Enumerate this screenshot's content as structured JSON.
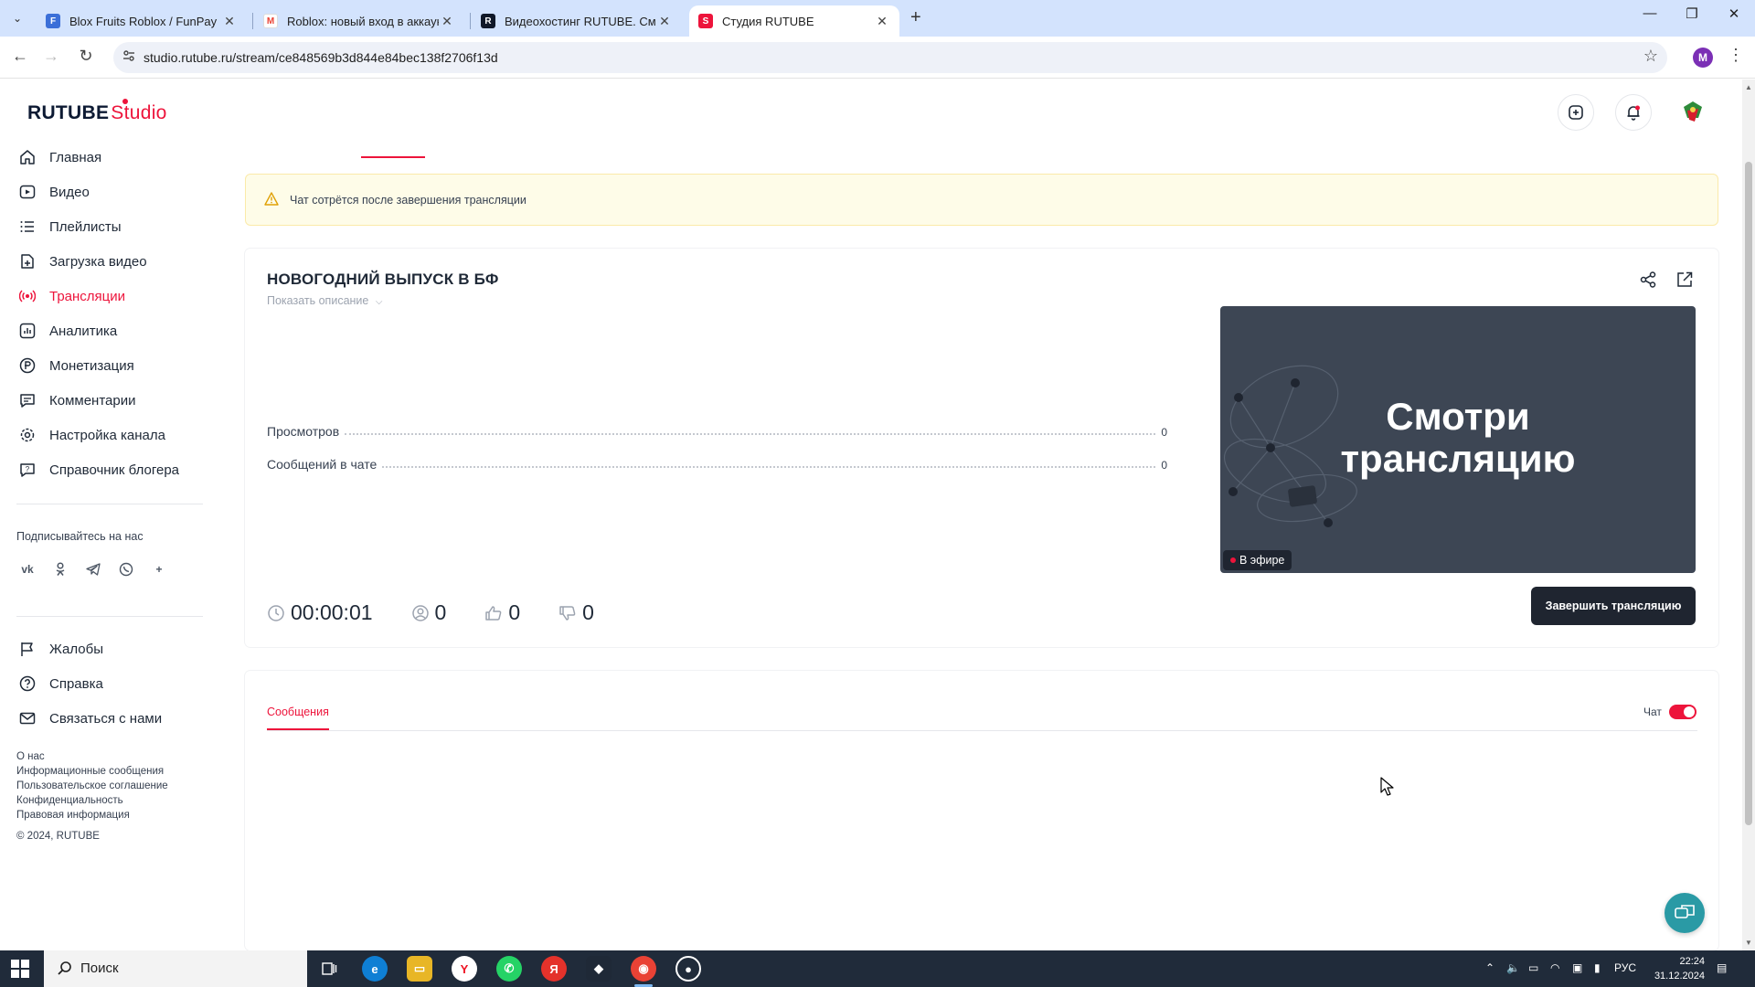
{
  "browser": {
    "tabs": [
      {
        "title": "Blox Fruits Roblox / FunPay",
        "favicon": "F",
        "color": "#3b6fd8"
      },
      {
        "title": "Roblox: новый вход в аккаунт",
        "favicon": "M",
        "color": "#ea4335"
      },
      {
        "title": "Видеохостинг RUTUBE. Смотр",
        "favicon": "R",
        "color": "#101828"
      },
      {
        "title": "Студия RUTUBE",
        "favicon": "S",
        "color": "#ed143b"
      }
    ],
    "url": "studio.rutube.ru/stream/ce848569b3d844e84bec138f2706f13d",
    "profile_initial": "M"
  },
  "app": {
    "logo_main": "RUTUBE",
    "logo_studio": "Studio"
  },
  "sidebar": {
    "items": [
      {
        "label": "Главная",
        "icon": "home-icon"
      },
      {
        "label": "Видео",
        "icon": "video-icon"
      },
      {
        "label": "Плейлисты",
        "icon": "playlist-icon"
      },
      {
        "label": "Загрузка видео",
        "icon": "upload-icon"
      },
      {
        "label": "Трансляции",
        "icon": "broadcast-icon"
      },
      {
        "label": "Аналитика",
        "icon": "analytics-icon"
      },
      {
        "label": "Монетизация",
        "icon": "monetization-icon"
      },
      {
        "label": "Комментарии",
        "icon": "comments-icon"
      },
      {
        "label": "Настройка канала",
        "icon": "settings-icon"
      },
      {
        "label": "Справочник блогера",
        "icon": "guide-icon"
      }
    ],
    "active_index": 4,
    "subscribe_heading": "Подписывайтесь на нас",
    "socials": [
      "vk",
      "ok",
      "telegram",
      "viber",
      "more"
    ],
    "bottom_items": [
      {
        "label": "Жалобы",
        "icon": "flag-icon"
      },
      {
        "label": "Справка",
        "icon": "help-icon"
      },
      {
        "label": "Связаться с нами",
        "icon": "mail-icon"
      }
    ],
    "footer_links": [
      "О нас",
      "Информационные сообщения",
      "Пользовательское соглашение",
      "Конфиденциальность",
      "Правовая информация"
    ],
    "copyright": "© 2024, RUTUBE"
  },
  "alert": {
    "text": "Чат сотрётся после завершения трансляции"
  },
  "stream": {
    "title": "НОВОГОДНИЙ ВЫПУСК В БФ",
    "show_description": "Показать описание",
    "stats": [
      {
        "label": "Просмотров",
        "value": "0"
      },
      {
        "label": "Сообщений в чате",
        "value": "0"
      }
    ],
    "preview_line1": "Смотри",
    "preview_line2": "трансляцию",
    "live_badge": "В эфире",
    "duration": "00:00:01",
    "viewers": "0",
    "likes": "0",
    "dislikes": "0",
    "end_button": "Завершить трансляцию"
  },
  "messages": {
    "tab": "Сообщения",
    "chat_label": "Чат",
    "chat_enabled": true
  },
  "taskbar": {
    "search": "Поиск",
    "lang": "РУС",
    "time": "22:24",
    "date": "31.12.2024"
  },
  "colors": {
    "accent": "#ed143b",
    "dark": "#1f2530"
  }
}
